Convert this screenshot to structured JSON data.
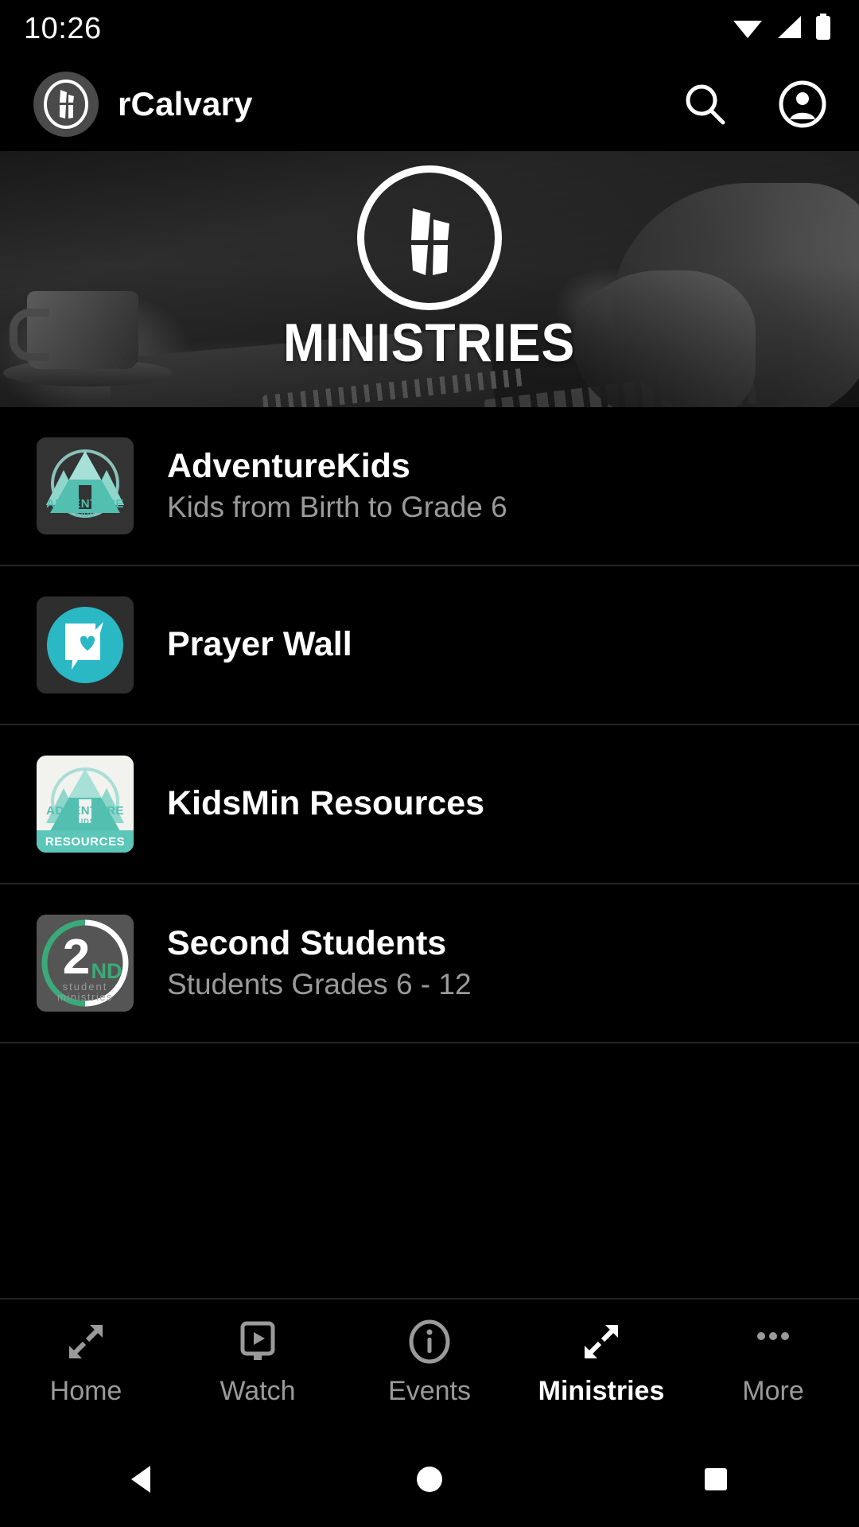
{
  "status_bar": {
    "time": "10:26",
    "icons": [
      "wifi-icon",
      "cellular-signal-icon",
      "battery-icon"
    ]
  },
  "app_bar": {
    "brand_title": "rCalvary",
    "brand_logo_icon": "church-cross-logo-icon",
    "search_icon": "search-icon",
    "account_icon": "account-circle-icon"
  },
  "hero": {
    "logo_icon": "church-cross-logo-icon",
    "label": "MINISTRIES"
  },
  "ministries": [
    {
      "title": "AdventureKids",
      "subtitle": "Kids from Birth to Grade 6",
      "thumb": "adventure-kids-logo",
      "thumb_word": "ADVENTURE",
      "thumb_word_sub": "KIDS"
    },
    {
      "title": "Prayer Wall",
      "subtitle": "",
      "thumb": "prayer-wall-logo"
    },
    {
      "title": "KidsMin Resources",
      "subtitle": "",
      "thumb": "kidsmin-resources-logo",
      "thumb_word": "ADVENTURE",
      "thumb_word_sub": "KIDS",
      "thumb_band": "RESOURCES"
    },
    {
      "title": "Second Students",
      "subtitle": "Students Grades 6 - 12",
      "thumb": "second-students-logo",
      "thumb_number": "2",
      "thumb_nd": "ND",
      "thumb_line1": "student",
      "thumb_line2": "ministries"
    }
  ],
  "bottom_nav": {
    "active": "Ministries",
    "items": [
      {
        "label": "Home",
        "icon": "compress-arrows-icon"
      },
      {
        "label": "Watch",
        "icon": "media-play-screen-icon"
      },
      {
        "label": "Events",
        "icon": "info-circle-icon"
      },
      {
        "label": "Ministries",
        "icon": "compress-arrows-icon"
      },
      {
        "label": "More",
        "icon": "ellipsis-icon"
      }
    ]
  },
  "android_nav": {
    "back": "back-triangle-icon",
    "home": "home-circle-icon",
    "recents": "recents-square-icon"
  },
  "colors": {
    "background": "#000000",
    "accent_teal": "#29b8c4",
    "accent_mint": "#52bfb0",
    "accent_green": "#3aab78",
    "text_primary": "#ffffff",
    "text_secondary": "#9a9a9a",
    "divider": "#242424"
  }
}
